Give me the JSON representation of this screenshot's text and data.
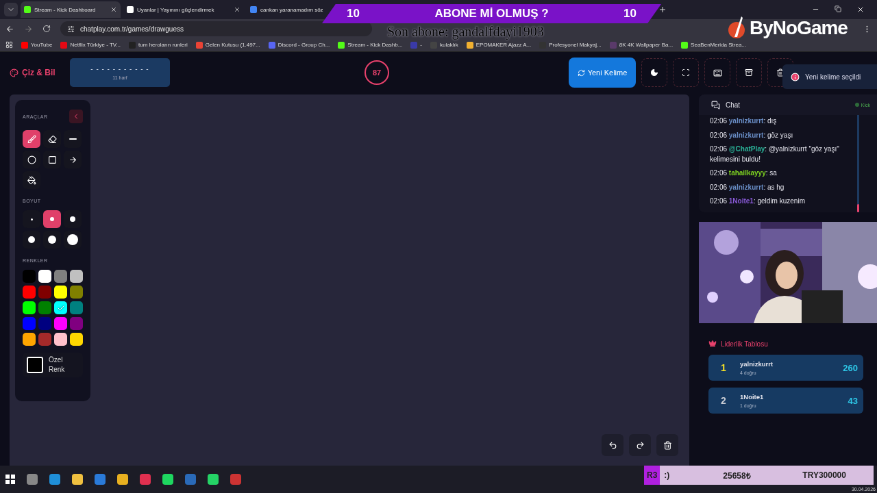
{
  "browser": {
    "tabs": [
      {
        "title": "Stream - Kick Dashboard",
        "selected": true
      },
      {
        "title": "Uyanlar | Yayınını güçlendirmek",
        "selected": false
      },
      {
        "title": "cankan yaranamadım söz",
        "selected": false
      }
    ],
    "url": "chatplay.com.tr/games/drawguess",
    "bookmarks": [
      {
        "label": "YouTube",
        "color": "#ff0000"
      },
      {
        "label": "Netflix Türkiye - TV...",
        "color": "#e50914"
      },
      {
        "label": "tum heroların runleri",
        "color": "#222222"
      },
      {
        "label": "Gelen Kutusu (1.497...",
        "color": "#ea4335"
      },
      {
        "label": "Discord - Group Ch...",
        "color": "#5865f2"
      },
      {
        "label": "Stream - Kick Dashb...",
        "color": "#53fc18"
      },
      {
        "label": "-",
        "color": "#3a3aa8"
      },
      {
        "label": "kulaklık",
        "color": "#444444"
      },
      {
        "label": "EPOMAKER Ajazz A...",
        "color": "#f0b030"
      },
      {
        "label": "Profesyonel Makyaj...",
        "color": "#333333"
      },
      {
        "label": "8K 4K Wallpaper Ba...",
        "color": "#5a3a6a"
      },
      {
        "label": "SeaBenMerida Strea...",
        "color": "#53fc18"
      }
    ]
  },
  "overlay": {
    "banner": {
      "left_count": "10",
      "title": "ABONE Mİ OLMUŞ ?",
      "right_count": "10"
    },
    "last_subscriber": "Son abone: gandalfdayi1903",
    "logo": "ByNoGame",
    "donation": {
      "tag": "R3",
      "message": ":)",
      "amount": "25658₺",
      "goal": "TRY300000"
    }
  },
  "app": {
    "title": "Çiz & Bil",
    "word": {
      "mask": "- - - - - - - - - - -",
      "hint": "11 harf"
    },
    "timer": "87",
    "new_word_button": "Yeni Kelime",
    "toast": "Yeni kelime seçildi"
  },
  "tools": {
    "title": "ARAÇLAR",
    "items": [
      {
        "kind": "brush",
        "selected": true
      },
      {
        "kind": "eraser",
        "selected": false
      },
      {
        "kind": "line",
        "selected": false
      },
      {
        "kind": "circle",
        "selected": false
      },
      {
        "kind": "square",
        "selected": false
      },
      {
        "kind": "arrow",
        "selected": false
      },
      {
        "kind": "fill",
        "selected": false
      }
    ],
    "size_title": "BOYUT",
    "sizes": [
      {
        "selected": false
      },
      {
        "selected": true
      },
      {
        "selected": false
      },
      {
        "selected": false
      },
      {
        "selected": false
      },
      {
        "selected": false
      }
    ],
    "colors_title": "RENKLER",
    "colors": [
      {
        "color": "#000000",
        "selected": false
      },
      {
        "color": "#ffffff",
        "selected": false
      },
      {
        "color": "#808080",
        "selected": false
      },
      {
        "color": "#c0c0c0",
        "selected": false
      },
      {
        "color": "#ff0000",
        "selected": false
      },
      {
        "color": "#800000",
        "selected": false
      },
      {
        "color": "#ffff00",
        "selected": false
      },
      {
        "color": "#808000",
        "selected": false
      },
      {
        "color": "#00ff00",
        "selected": false
      },
      {
        "color": "#008000",
        "selected": false
      },
      {
        "color": "#00ffff",
        "selected": true
      },
      {
        "color": "#008080",
        "selected": false
      },
      {
        "color": "#0000ff",
        "selected": false
      },
      {
        "color": "#000080",
        "selected": false
      },
      {
        "color": "#ff00ff",
        "selected": false
      },
      {
        "color": "#800080",
        "selected": false
      },
      {
        "color": "#ffa500",
        "selected": false
      },
      {
        "color": "#a52a2a",
        "selected": false
      },
      {
        "color": "#ffc0cb",
        "selected": false
      },
      {
        "color": "#ffd700",
        "selected": false
      }
    ],
    "custom_color": "Özel Renk"
  },
  "chat": {
    "title": "Chat",
    "source": "Kick",
    "messages": [
      {
        "time": "02:06",
        "user": "yalnizkurrt",
        "color": "#6a8fc8",
        "text": ": dış"
      },
      {
        "time": "02:06",
        "user": "yalnizkurrt",
        "color": "#6a8fc8",
        "text": ": göz yaşı"
      },
      {
        "time": "02:06",
        "user": "@ChatPlay",
        "color": "#2bb59a",
        "text": ": @yalnizkurrt \"göz yaşı\" kelimesini buldu!"
      },
      {
        "time": "02:06",
        "user": "tahailkayyy",
        "color": "#7ed321",
        "text": ": sa"
      },
      {
        "time": "02:06",
        "user": "yalnizkurrt",
        "color": "#6a8fc8",
        "text": ": as hg"
      },
      {
        "time": "02:06",
        "user": "1Noite1",
        "color": "#8a5ad8",
        "text": ": geldim kuzenim"
      }
    ]
  },
  "leaderboard": {
    "title": "Liderlik Tablosu",
    "entries": [
      {
        "rank": "1",
        "color": "#f5e027",
        "name": "yalnizkurrt",
        "detail": "4 doğru",
        "score": "260"
      },
      {
        "rank": "2",
        "color": "#c8ccd4",
        "name": "1Noite1",
        "detail": "1 doğru",
        "score": "43"
      }
    ]
  },
  "taskbar": {
    "date": "30.04.2026"
  }
}
